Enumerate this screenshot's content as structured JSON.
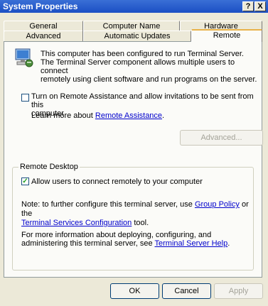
{
  "window": {
    "title": "System Properties",
    "help_button": "?",
    "close_button": "X"
  },
  "tabs": {
    "general": "General",
    "computer_name": "Computer Name",
    "hardware": "Hardware",
    "advanced": "Advanced",
    "automatic_updates": "Automatic Updates",
    "remote": "Remote"
  },
  "intro": {
    "line1": "This computer has been configured to run Terminal Server.",
    "line2": "The Terminal Server component allows multiple users to connect",
    "line3": "remotely using client software and run programs on the server."
  },
  "remote_assistance": {
    "checkbox_label_1": "Turn on Remote Assistance and allow invitations to be sent from this",
    "checkbox_label_2": "computer",
    "checked": false,
    "learn_more_prefix": "Learn more about ",
    "learn_more_link": "Remote Assistance",
    "learn_more_suffix": ".",
    "advanced_button": "Advanced..."
  },
  "remote_desktop": {
    "group_label": "Remote Desktop",
    "checkbox_label": "Allow users to connect remotely to your computer",
    "checked": true,
    "checkmark": "✓",
    "note_prefix": "Note: to further configure this terminal server, use ",
    "group_policy_link": "Group Policy",
    "note_middle": " or the",
    "tsc_link": "Terminal Services Configuration",
    "note_suffix": " tool.",
    "info_text": "For more information about deploying, configuring, and administering this terminal server, see ",
    "help_link": "Terminal Server Help",
    "info_suffix": "."
  },
  "buttons": {
    "ok": "OK",
    "cancel": "Cancel",
    "apply": "Apply"
  }
}
